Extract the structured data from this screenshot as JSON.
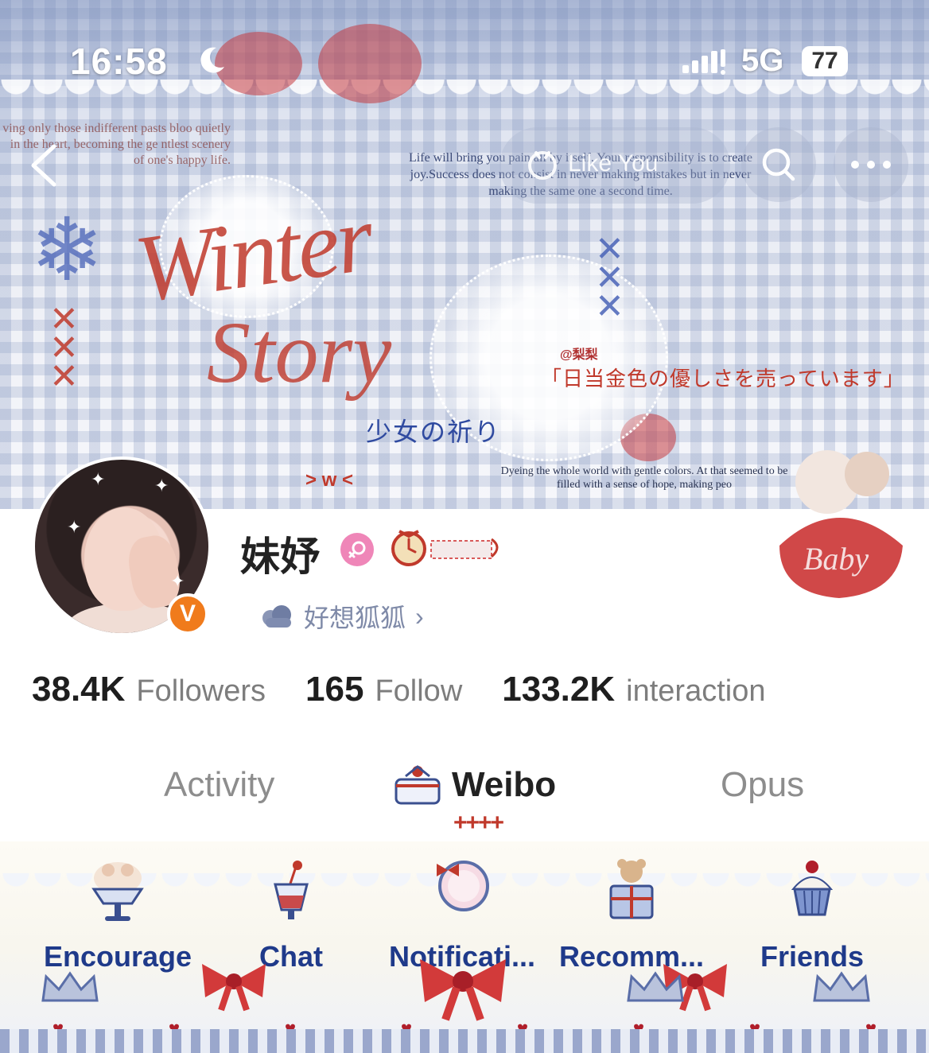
{
  "status_bar": {
    "time": "16:58",
    "network": "5G",
    "battery": "77"
  },
  "header": {
    "like_you_label": "Like You",
    "quote_left": "ving only those indifferent pasts bloo quietly in the heart, becoming the ge ntlest scenery of one's happy life.",
    "quote_center": "Life will bring you pain all by itself. Your responsibility is to create joy.Success does not consist in never making mistakes but in never making the same one a second time.",
    "quote_bottom": "Dyeing the whole world with gentle colors. At that seemed to be filled with a sense of hope, making peo",
    "title_script_1": "Winter",
    "title_script_2": "Story",
    "tag": "@梨梨",
    "jp_line": "「日当金色の優しさを売っています」",
    "girl_prayer": "少女の祈り",
    "emote": "> w <"
  },
  "profile": {
    "username": "妹妤",
    "status_text": "好想狐狐",
    "verified_badge": "V"
  },
  "stats": [
    {
      "value": "38.4K",
      "label": "Followers"
    },
    {
      "value": "165",
      "label": "Follow"
    },
    {
      "value": "133.2K",
      "label": "interaction"
    }
  ],
  "tabs": [
    {
      "label": "Activity"
    },
    {
      "label": "Weibo"
    },
    {
      "label": "Opus"
    }
  ],
  "tab_marker": "++++",
  "bottom_nav": [
    {
      "label": "Encourage"
    },
    {
      "label": "Chat"
    },
    {
      "label": "Notificati..."
    },
    {
      "label": "Recomm..."
    },
    {
      "label": "Friends"
    }
  ],
  "colors": {
    "accent_red": "#c0392b",
    "nav_blue": "#1f3a8a",
    "badge_orange": "#f07b1c",
    "gender_pink": "#ef86b8"
  }
}
